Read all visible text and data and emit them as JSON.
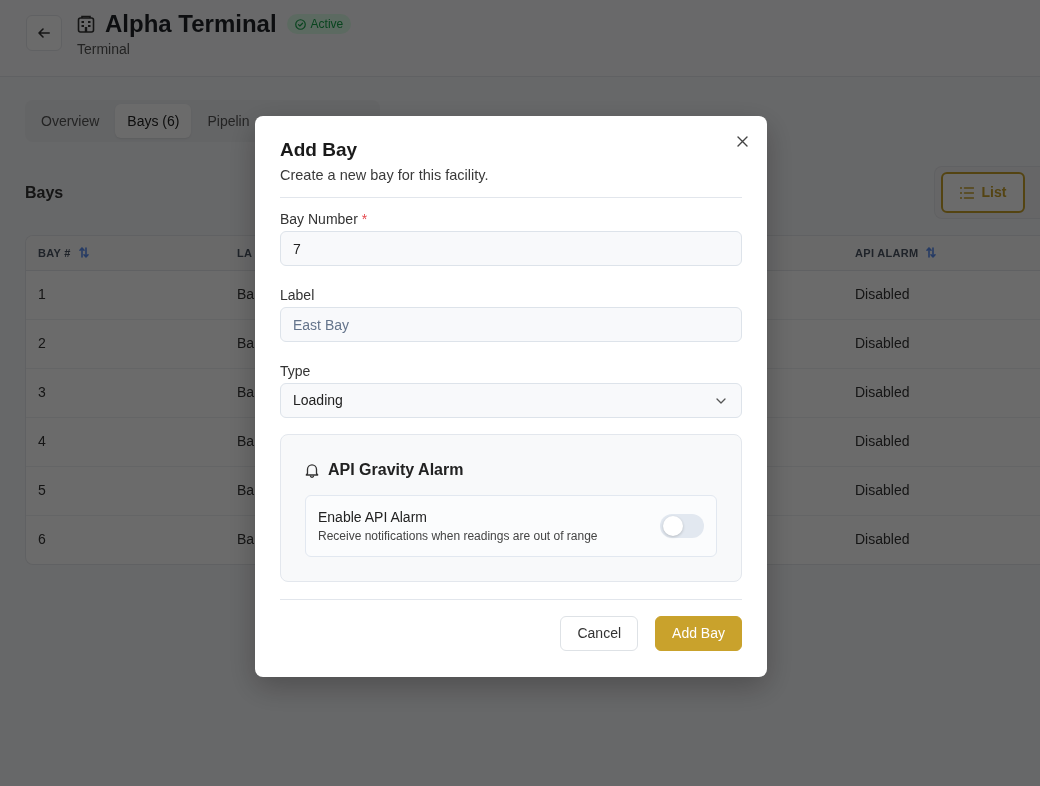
{
  "page": {
    "title": "Alpha Terminal",
    "status_badge": "Active",
    "subtitle": "Terminal",
    "tabs": [
      {
        "label": "Overview",
        "selected": false
      },
      {
        "label": "Bays (6)",
        "selected": true
      },
      {
        "label": "Pipelin",
        "selected": false
      }
    ],
    "section_title": "Bays",
    "view_toggle": [
      {
        "label": "List",
        "selected": true
      }
    ],
    "table": {
      "columns": [
        {
          "label": "BAY #",
          "sortable": true
        },
        {
          "label": "LA",
          "sortable": false
        },
        {
          "label": "API ALARM",
          "sortable": true
        }
      ],
      "rows": [
        [
          "1",
          "Ba",
          "Disabled"
        ],
        [
          "2",
          "Ba",
          "Disabled"
        ],
        [
          "3",
          "Ba",
          "Disabled"
        ],
        [
          "4",
          "Ba",
          "Disabled"
        ],
        [
          "5",
          "Ba",
          "Disabled"
        ],
        [
          "6",
          "Ba",
          "Disabled"
        ]
      ]
    }
  },
  "modal": {
    "title": "Add Bay",
    "subtitle": "Create a new bay for this facility.",
    "fields": [
      {
        "kind": "input",
        "label": "Bay Number",
        "required_mark": "*",
        "value": "7"
      },
      {
        "kind": "input",
        "label": "Label",
        "placeholder": "East Bay"
      },
      {
        "kind": "select",
        "label": "Type",
        "value": "Loading"
      }
    ],
    "alarm_panel": {
      "title": "API Gravity Alarm",
      "setting": {
        "label": "Enable API Alarm",
        "description": "Receive notifications when readings are out of range",
        "on": false
      }
    },
    "buttons": [
      {
        "label": "Cancel",
        "kind": "secondary"
      },
      {
        "label": "Add Bay",
        "kind": "primary"
      }
    ]
  }
}
